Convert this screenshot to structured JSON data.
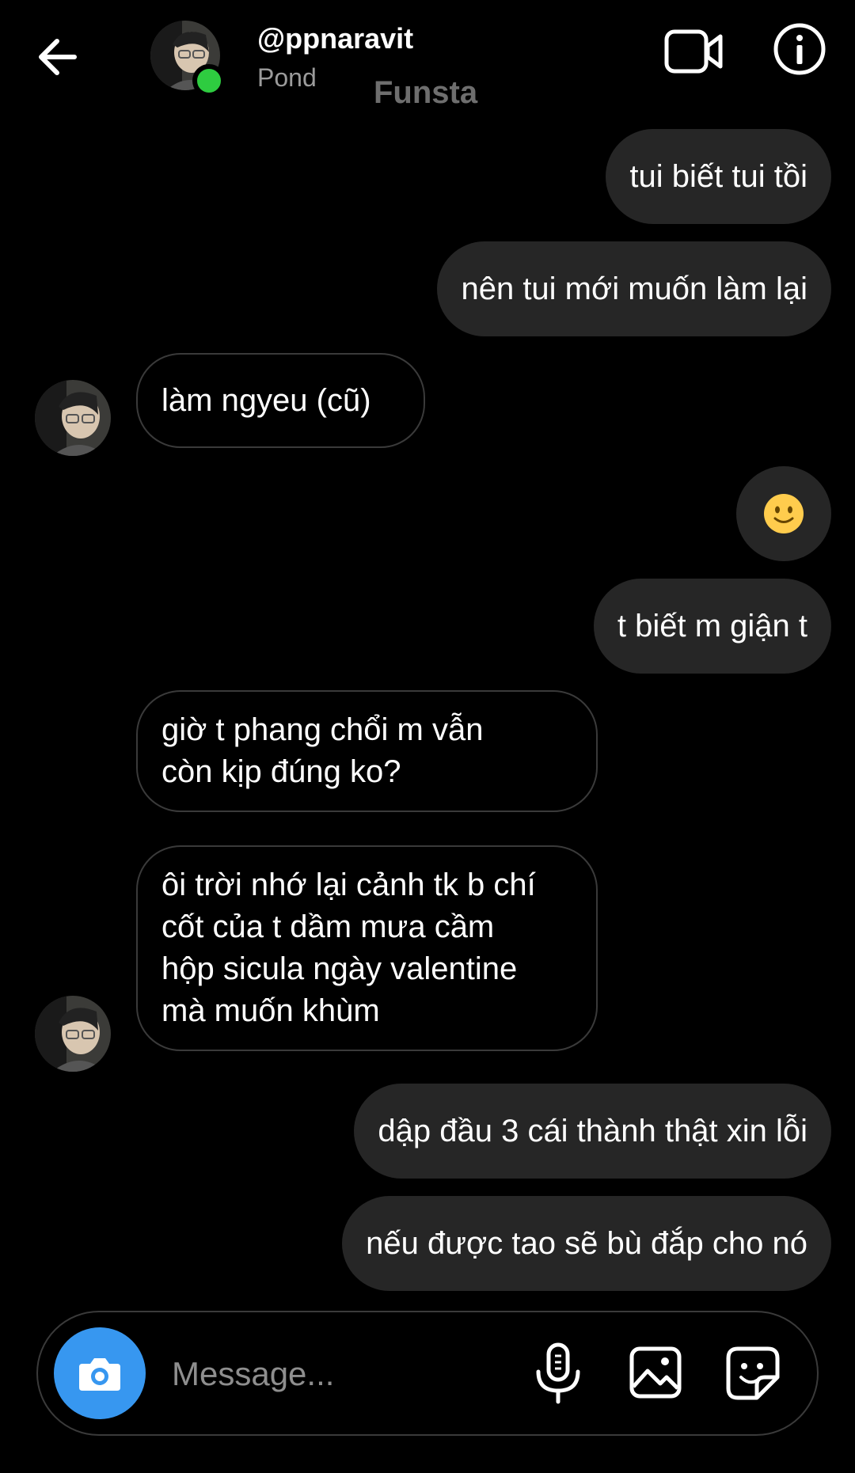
{
  "header": {
    "username": "@ppnaravit",
    "fullname": "Pond",
    "watermark": "Funsta"
  },
  "messages": [
    {
      "side": "out",
      "text": "tui biết tui tồi"
    },
    {
      "side": "out",
      "text": "nên tui mới muốn làm lại"
    },
    {
      "side": "in",
      "text": "làm ngyeu (cũ)"
    },
    {
      "side": "out",
      "emoji": "slightly-smiling-face"
    },
    {
      "side": "out",
      "text": "t biết m giận t"
    },
    {
      "side": "in",
      "lines": [
        "giờ t phang chổi m vẫn",
        "còn kịp đúng ko?"
      ]
    },
    {
      "side": "in",
      "lines": [
        "ôi trời nhớ lại cảnh tk b chí",
        "cốt của t dầm mưa cầm",
        "hộp sicula ngày valentine",
        "mà muốn khùm"
      ]
    },
    {
      "side": "out",
      "text": "dập đầu 3 cái thành thật xin lỗi"
    },
    {
      "side": "out",
      "text": "nếu được tao sẽ bù đắp cho nó"
    }
  ],
  "composer": {
    "placeholder": "Message..."
  },
  "colors": {
    "online": "#2ecc40",
    "camera": "#3797f0",
    "bubble_out": "#262626"
  }
}
